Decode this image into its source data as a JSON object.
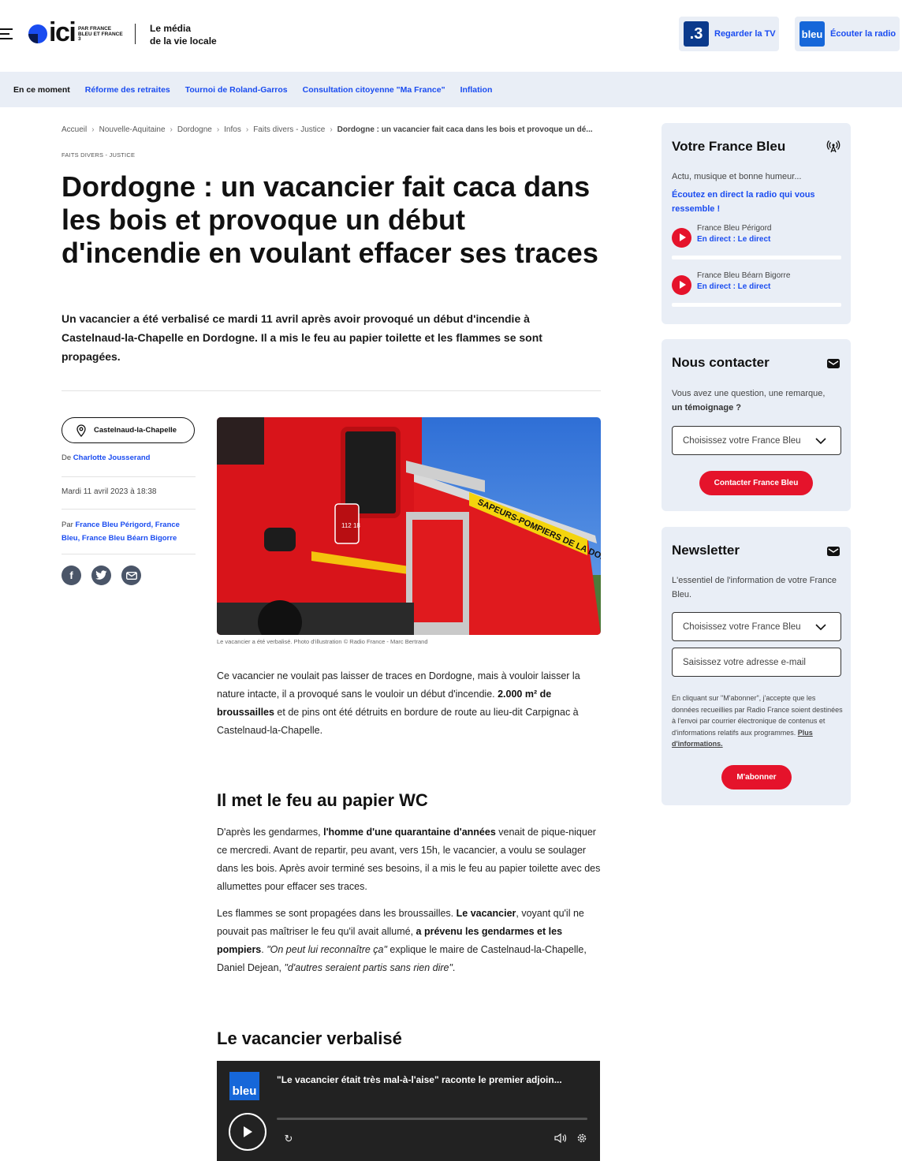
{
  "header": {
    "logo_word": "ici",
    "logo_sub": "PAR FRANCE BLEU ET FRANCE 3",
    "tagline_line1": "Le média",
    "tagline_line2": "de la vie locale",
    "tv_badge": ".3",
    "tv_label": "Regarder la TV",
    "radio_badge": "bleu",
    "radio_label": "Écouter la radio"
  },
  "nav": {
    "items": [
      "En ce moment",
      "Réforme des retraites",
      "Tournoi de Roland-Garros",
      "Consultation citoyenne \"Ma France\"",
      "Inflation"
    ]
  },
  "breadcrumb": {
    "items": [
      "Accueil",
      "Nouvelle-Aquitaine",
      "Dordogne",
      "Infos",
      "Faits divers - Justice"
    ],
    "current": "Dordogne : un vacancier fait caca dans les bois et provoque un dé..."
  },
  "article": {
    "category": "FAITS DIVERS - JUSTICE",
    "title": "Dordogne : un vacancier fait caca dans les bois et provoque un début d'incendie en voulant effacer ses traces",
    "lead": "Un vacancier a été verbalisé ce mardi 11 avril après avoir provoqué un début d'incendie à Castelnaud-la-Chapelle en Dordogne. Il a mis le feu au papier toilette et les flammes se sont propagées.",
    "location": "Castelnaud-la-Chapelle",
    "author_prefix": "De",
    "author": "Charlotte Jousserand",
    "date": "Mardi 11 avril 2023 à 18:38",
    "par_prefix": "Par",
    "par_links": "France Bleu Périgord, France Bleu, France Bleu Béarn Bigorre",
    "photo_text": "SAPEURS-POMPIERS DE LA DORDOGNE",
    "photo_phone": "112 18",
    "caption": "Le vacancier a été verbalisé. Photo d'illustration © Radio France - Marc Bertrand",
    "p1_a": "Ce vacancier ne voulait pas laisser de traces en Dordogne, mais à vouloir laisser la nature intacte, il a provoqué sans le vouloir un début d'incendie. ",
    "p1_b": "2.000 m² de broussailles",
    "p1_c": " et de pins ont été détruits en bordure de route au lieu-dit Carpignac à Castelnaud-la-Chapelle.",
    "h2_1": "Il met le feu au papier WC",
    "p2_a": "D'après les gendarmes, ",
    "p2_b": "l'homme d'une quarantaine d'années",
    "p2_c": " venait de pique-niquer ce mercredi. Avant de repartir, peu avant, vers 15h, le vacancier, a voulu se soulager dans les bois. Après avoir terminé ses besoins, il a mis le feu au papier toilette avec des allumettes pour effacer ses traces.",
    "p3_a": "Les flammes se sont propagées dans les broussailles. ",
    "p3_b": "Le vacancier",
    "p3_c": ", voyant qu'il ne pouvait pas maîtriser le feu qu'il avait allumé, ",
    "p3_d": "a prévenu les gendarmes et les pompiers",
    "p3_e": ". ",
    "p3_f": "\"On peut lui reconnaître ça\"",
    "p3_g": " explique le maire de Castelnaud-la-Chapelle, Daniel Dejean, ",
    "p3_h": "\"d'autres seraient partis sans rien dire\"",
    "p3_i": ".",
    "h2_2": "Le vacancier verbalisé"
  },
  "player": {
    "logo": "bleu",
    "title": "\"Le vacancier était très mal-à-l'aise\" raconte le premier adjoin...",
    "progress": 0
  },
  "sidebar": {
    "radio_card": {
      "title": "Votre France Bleu",
      "text": "Actu, musique et bonne humeur...",
      "cta": "Écoutez en direct la radio qui vous ressemble !",
      "stations": [
        {
          "name": "France Bleu Périgord",
          "live": "En direct : Le direct"
        },
        {
          "name": "France Bleu Béarn Bigorre",
          "live": "En direct : Le direct"
        }
      ]
    },
    "contact_card": {
      "title": "Nous contacter",
      "text": "Vous avez une question, une remarque,",
      "text_strong": "un témoignage ?",
      "select": "Choisissez votre France Bleu",
      "button": "Contacter France Bleu"
    },
    "newsletter_card": {
      "title": "Newsletter",
      "text": "L'essentiel de l'information de votre France Bleu.",
      "select": "Choisissez votre France Bleu",
      "email_placeholder": "Saisissez votre adresse e-mail",
      "legal": "En cliquant sur \"M'abonner\", j'accepte que les données recueillies par Radio France soient destinées à l'envoi par courrier électronique de contenus et d'informations relatifs aux programmes. ",
      "legal_link": "Plus d'informations.",
      "button": "M'abonner"
    }
  },
  "colors": {
    "brand_blue": "#1a4cf0",
    "accent_red": "#e5132b",
    "panel_bg": "#e9eef6"
  }
}
